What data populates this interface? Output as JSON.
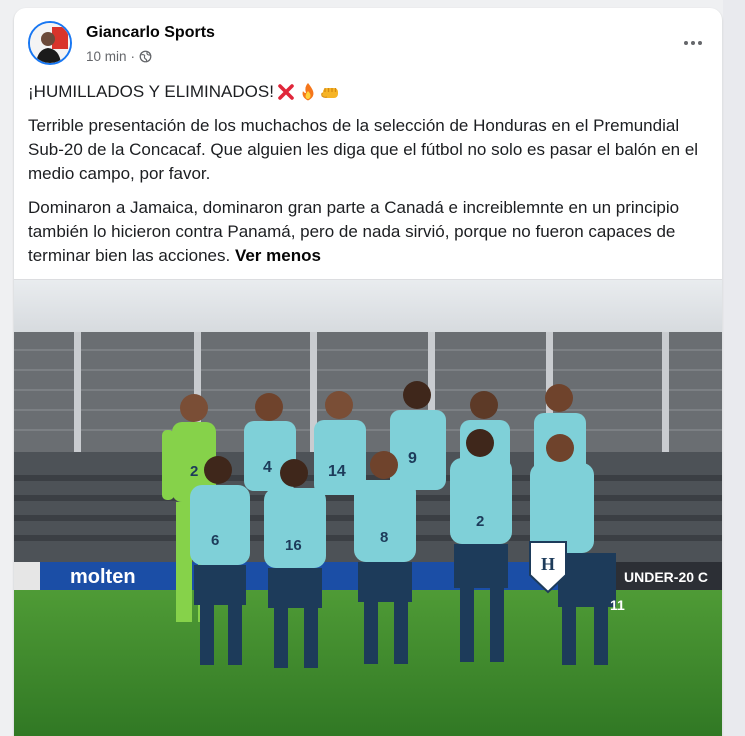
{
  "post": {
    "author": "Giancarlo Sports",
    "time": "10 min",
    "separator": "·",
    "headline": "¡HUMILLADOS Y ELIMINADOS!",
    "headline_icons": [
      "cross-mark-icon",
      "fire-icon",
      "fist-icon"
    ],
    "paragraph1": "Terrible presentación de los muchachos de la selección de Honduras en el Premundial Sub-20 de la Concacaf. Que alguien les diga que el fútbol no solo es pasar el balón en el medio campo, por favor.",
    "paragraph2": "Dominaron a Jamaica, dominaron gran parte a Canadá e increiblemnte en un principio también lo hicieron contra Panamá, pero de nada sirvió, porque no fueron capaces de terminar bien las acciones.",
    "see_less": "Ver menos"
  },
  "photo": {
    "banner_left": "molten",
    "banner_right": "UNDER-20 C",
    "jersey_numbers": [
      "2",
      "4",
      "14",
      "9",
      "6",
      "16",
      "8",
      "2",
      "11"
    ]
  },
  "colors": {
    "jersey": "#7fd0d8",
    "shorts": "#1d3b5a",
    "keeper": "#86d24a",
    "grass": "#3f8f2e",
    "stand": "#5e6266",
    "banner": "#1b4ea6"
  }
}
